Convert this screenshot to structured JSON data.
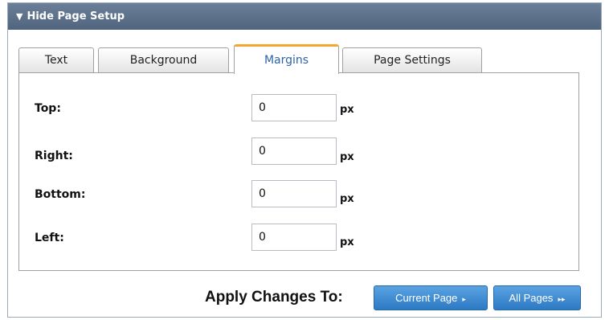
{
  "header": {
    "arrow_icon": "▼",
    "title": "Hide Page Setup"
  },
  "tabs": [
    {
      "label": "Text",
      "active": false
    },
    {
      "label": "Background",
      "active": false
    },
    {
      "label": "Margins",
      "active": true
    },
    {
      "label": "Page Settings",
      "active": false
    }
  ],
  "margins": {
    "top": {
      "label": "Top:",
      "value": "0",
      "unit": "px"
    },
    "right": {
      "label": "Right:",
      "value": "0",
      "unit": "px"
    },
    "bottom": {
      "label": "Bottom:",
      "value": "0",
      "unit": "px"
    },
    "left": {
      "label": "Left:",
      "value": "0",
      "unit": "px"
    }
  },
  "apply": {
    "label": "Apply Changes To:",
    "current_page_label": "Current Page",
    "current_page_icon": "▸",
    "all_pages_label": "All Pages",
    "all_pages_icon": "▸▸"
  },
  "colors": {
    "header_bg": "#5b6f88",
    "active_tab_accent": "#f0a830",
    "active_tab_text": "#2e62a8",
    "button_bg": "#3b87d0"
  }
}
